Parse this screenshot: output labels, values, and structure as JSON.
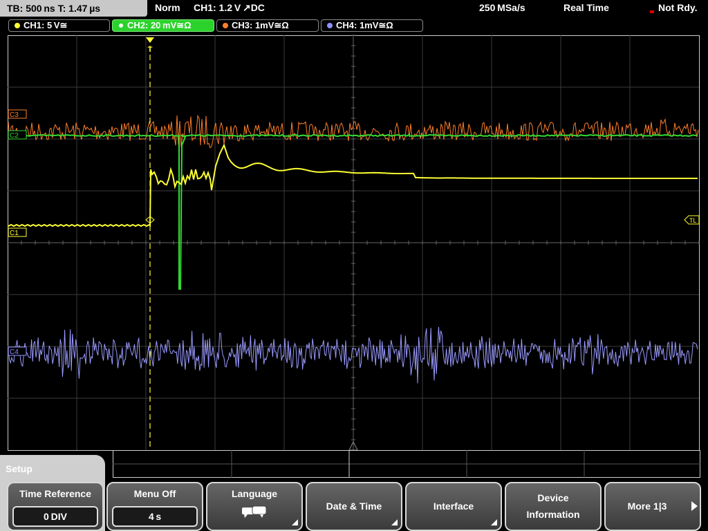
{
  "status_bar": {
    "timebase": "TB: 500 ns   T: 1.47 µs",
    "mode": "Norm",
    "trigger": "CH1: 1.2 V ↗DC",
    "sample_rate": "250 MSa/s",
    "acq_mode": "Real Time",
    "state": "Not Rdy."
  },
  "channels": [
    {
      "label": "CH1: 5 V≅",
      "color": "#ffff33"
    },
    {
      "label": "CH2: 20 mV≅Ω",
      "color": "#33ff33",
      "selected": true
    },
    {
      "label": "CH3: 1mV≅Ω",
      "color": "#ff7f2a"
    },
    {
      "label": "CH4: 1mV≅Ω",
      "color": "#8f8fff"
    }
  ],
  "markers": {
    "c3": "C3",
    "c2": "C2",
    "c1": "C1",
    "c4": "C4",
    "trigger_level": "TL",
    "trigger_pos": "T"
  },
  "menu": {
    "title": "Setup",
    "softkeys": [
      {
        "label": "Time Reference",
        "value": "0 DIV"
      },
      {
        "label": "Menu Off",
        "value": "4 s"
      },
      {
        "label": "Language",
        "icon": "speech-bubbles-icon"
      },
      {
        "label": "Date & Time"
      },
      {
        "label": "Interface"
      },
      {
        "label_line1": "Device",
        "label_line2": "Information"
      },
      {
        "label": "More 1|3"
      }
    ]
  }
}
